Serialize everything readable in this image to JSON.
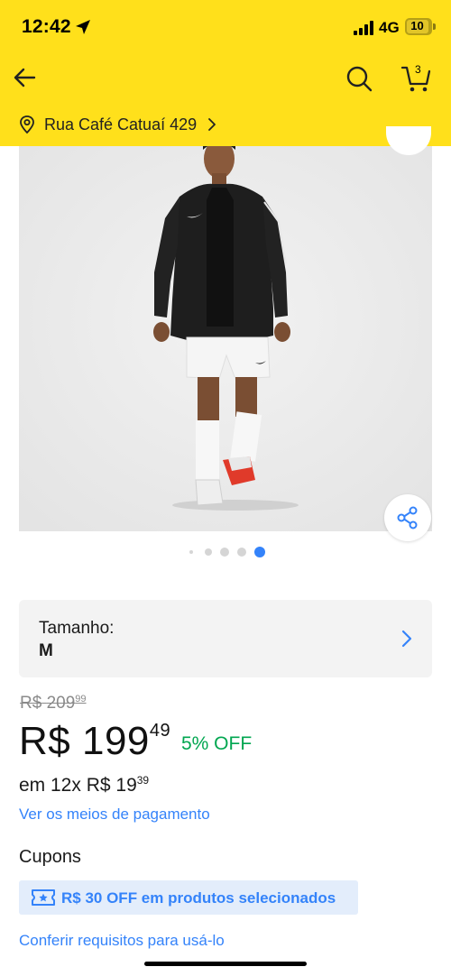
{
  "status_bar": {
    "time": "12:42",
    "network": "4G",
    "battery": "10"
  },
  "header": {
    "cart_count": "3",
    "address": "Rua Café Catuaí 429"
  },
  "gallery": {
    "image_count": 5,
    "active_index": 4
  },
  "size_selector": {
    "label": "Tamanho:",
    "value": "M"
  },
  "pricing": {
    "old_currency": "R$",
    "old_integer": "209",
    "old_cents": "99",
    "currency": "R$",
    "integer": "199",
    "cents": "49",
    "discount": "5% OFF",
    "installments_prefix": "em 12x R$",
    "installment_integer": "19",
    "installment_cents": "39",
    "payment_link": "Ver os meios de pagamento"
  },
  "coupons": {
    "title": "Cupons",
    "badge_text": "R$ 30 OFF em produtos selecionados",
    "requirements_link": "Conferir requisitos para usá-lo"
  },
  "colors": {
    "header_bg": "#ffe01b",
    "link_blue": "#3483fa",
    "discount_green": "#00a650",
    "coupon_bg": "#e3edfb",
    "active_dot": "#3483fa"
  }
}
